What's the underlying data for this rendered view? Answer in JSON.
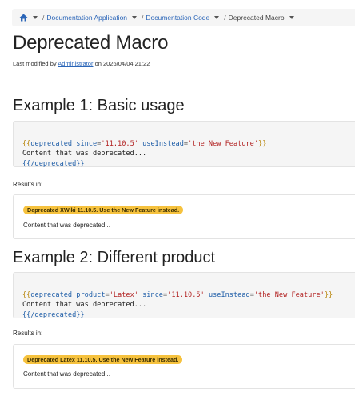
{
  "breadcrumb": {
    "items": [
      {
        "label": "Documentation Application"
      },
      {
        "label": "Documentation Code"
      },
      {
        "label": "Deprecated Macro"
      }
    ]
  },
  "page": {
    "title": "Deprecated Macro",
    "meta_prefix": "Last modified by ",
    "meta_author": "Administrator",
    "meta_suffix": " on 2026/04/04 21:22"
  },
  "examples": [
    {
      "title": "Example 1: Basic usage",
      "code": {
        "open_brace": "{{",
        "macro": "deprecated",
        "attrs": [
          {
            "name": "since",
            "value": "'11.10.5'"
          },
          {
            "name": "useInstead",
            "value": "'the New Feature'"
          }
        ],
        "close_brace": "}}",
        "content": "Content that was deprecated...",
        "end_tag": "{{/deprecated}}"
      },
      "results_label": "Results in:",
      "badge": "Deprecated XWiki 11.10.5. Use the New Feature instead.",
      "result_text": "Content that was deprecated..."
    },
    {
      "title": "Example 2: Different product",
      "code": {
        "open_brace": "{{",
        "macro": "deprecated",
        "attrs": [
          {
            "name": "product",
            "value": "'Latex'"
          },
          {
            "name": "since",
            "value": "'11.10.5'"
          },
          {
            "name": "useInstead",
            "value": "'the New Feature'"
          }
        ],
        "close_brace": "}}",
        "content": "Content that was deprecated...",
        "end_tag": "{{/deprecated}}"
      },
      "results_label": "Results in:",
      "badge": "Deprecated Latex 11.10.5. Use the New Feature instead.",
      "result_text": "Content that was deprecated..."
    }
  ],
  "colors": {
    "link": "#2a65b8",
    "badge": "#f6c23e",
    "code_bg": "#f5f5f5"
  }
}
